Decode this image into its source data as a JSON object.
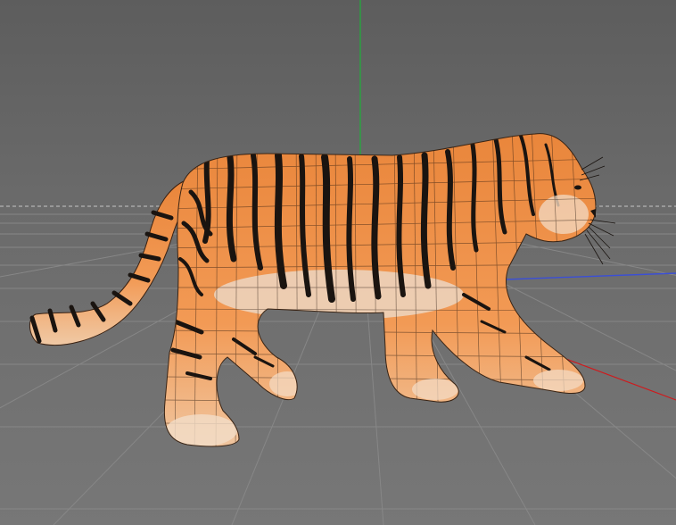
{
  "viewport": {
    "background_colors": [
      "#5d5d5d",
      "#6b6b6b",
      "#777777"
    ],
    "grid_color": "#8a8a8a",
    "horizon_color": "#bdbdbd",
    "axis_colors": {
      "x": "#d0191c",
      "y": "#1faf3a",
      "z": "#3b4fd6"
    }
  },
  "model": {
    "icon": "tiger-mesh-icon",
    "colors": {
      "fur": "#ea8a3f",
      "fur_light": "#f4b77f",
      "belly": "#e8d8c8",
      "stripe": "#1a1410",
      "wire": "#2a1a10"
    }
  }
}
